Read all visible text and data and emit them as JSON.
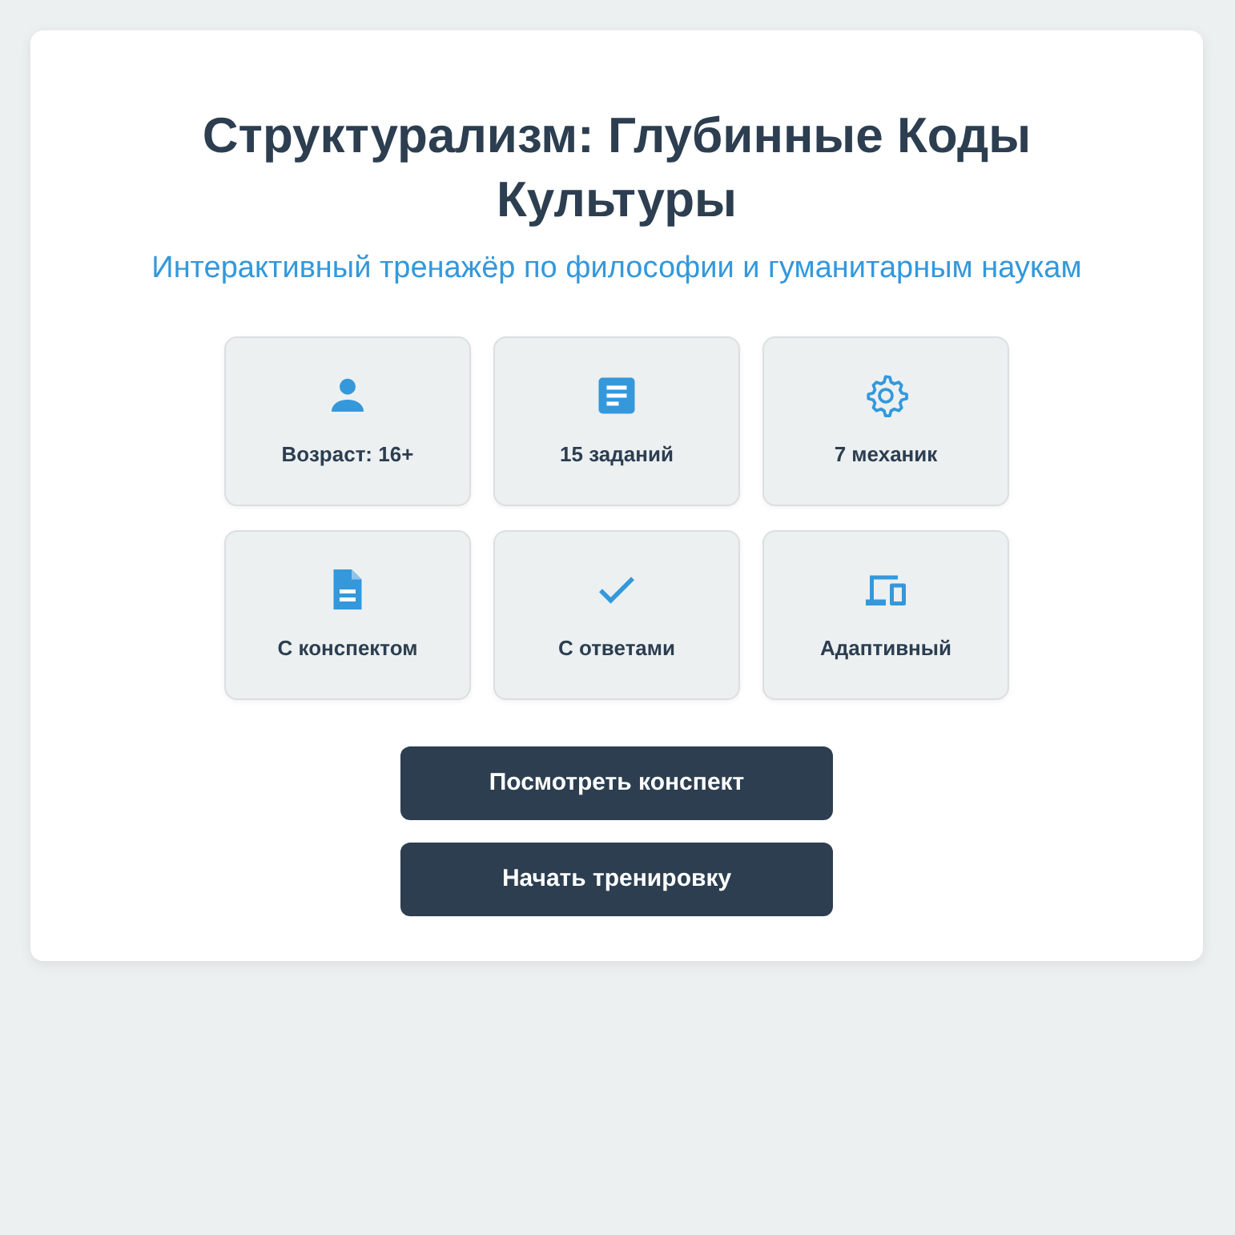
{
  "title": "Структурализм: Глубинные Коды Культуры",
  "subtitle": "Интерактивный тренажёр по философии и гуманитарным наукам",
  "features": [
    {
      "label": "Возраст: 16+"
    },
    {
      "label": "15 заданий"
    },
    {
      "label": "7 механик"
    },
    {
      "label": "С конспектом"
    },
    {
      "label": "С ответами"
    },
    {
      "label": "Адаптивный"
    }
  ],
  "buttons": [
    "Посмотреть конспект",
    "Начать тренировку"
  ]
}
